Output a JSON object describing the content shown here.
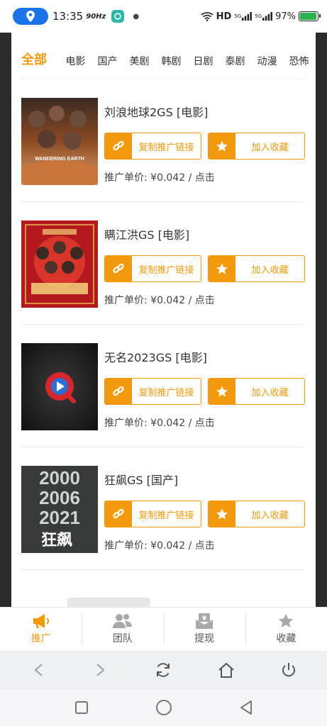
{
  "status_bar": {
    "time": "13:35",
    "refresh_rate": "90Hz",
    "network": "HD",
    "signal_1": "5G",
    "signal_2": "5G",
    "battery": "97%",
    "battery_level": 0.97
  },
  "categories": [
    {
      "label": "全部",
      "active": true
    },
    {
      "label": "电影",
      "active": false
    },
    {
      "label": "国产",
      "active": false
    },
    {
      "label": "美剧",
      "active": false
    },
    {
      "label": "韩剧",
      "active": false
    },
    {
      "label": "日剧",
      "active": false
    },
    {
      "label": "泰剧",
      "active": false
    },
    {
      "label": "动漫",
      "active": false
    },
    {
      "label": "恐怖",
      "active": false
    }
  ],
  "button_labels": {
    "copy_link": "复制推广链接",
    "add_favorite": "加入收藏"
  },
  "items": [
    {
      "title": "刘浪地球2GS [电影]",
      "price": "推广单价: ¥0.042 / 点击",
      "poster": "wandering-earth-poster"
    },
    {
      "title": "瞒江洪GS [电影]",
      "price": "推广单价: ¥0.042 / 点击",
      "poster": "red-festive-poster"
    },
    {
      "title": "无名2023GS [电影]",
      "price": "推广单价: ¥0.042 / 点击",
      "poster": "video-player-placeholder"
    },
    {
      "title": "狂飙GS [国产]",
      "price": "推广单价: ¥0.042 / 点击",
      "poster": "kuangbiao-poster"
    }
  ],
  "poster_text": {
    "item_1": "WANDERING EARTH",
    "item_4_years": [
      "2000",
      "2006",
      "2021"
    ],
    "item_4_name": "狂飙"
  },
  "bottom_nav": [
    {
      "label": "推广",
      "icon": "megaphone-icon",
      "active": true
    },
    {
      "label": "团队",
      "icon": "team-icon",
      "active": false
    },
    {
      "label": "提现",
      "icon": "withdraw-icon",
      "active": false
    },
    {
      "label": "收藏",
      "icon": "star-icon",
      "active": false
    }
  ],
  "browser_bar": [
    "back-icon",
    "forward-icon",
    "refresh-icon",
    "home-icon",
    "power-icon"
  ],
  "system_nav": [
    "recents-icon",
    "home-circle-icon",
    "back-triangle-icon"
  ],
  "colors": {
    "accent": "#f29a0c",
    "location_pill": "#1a73e8",
    "side_frame": "#2b2b2b"
  }
}
